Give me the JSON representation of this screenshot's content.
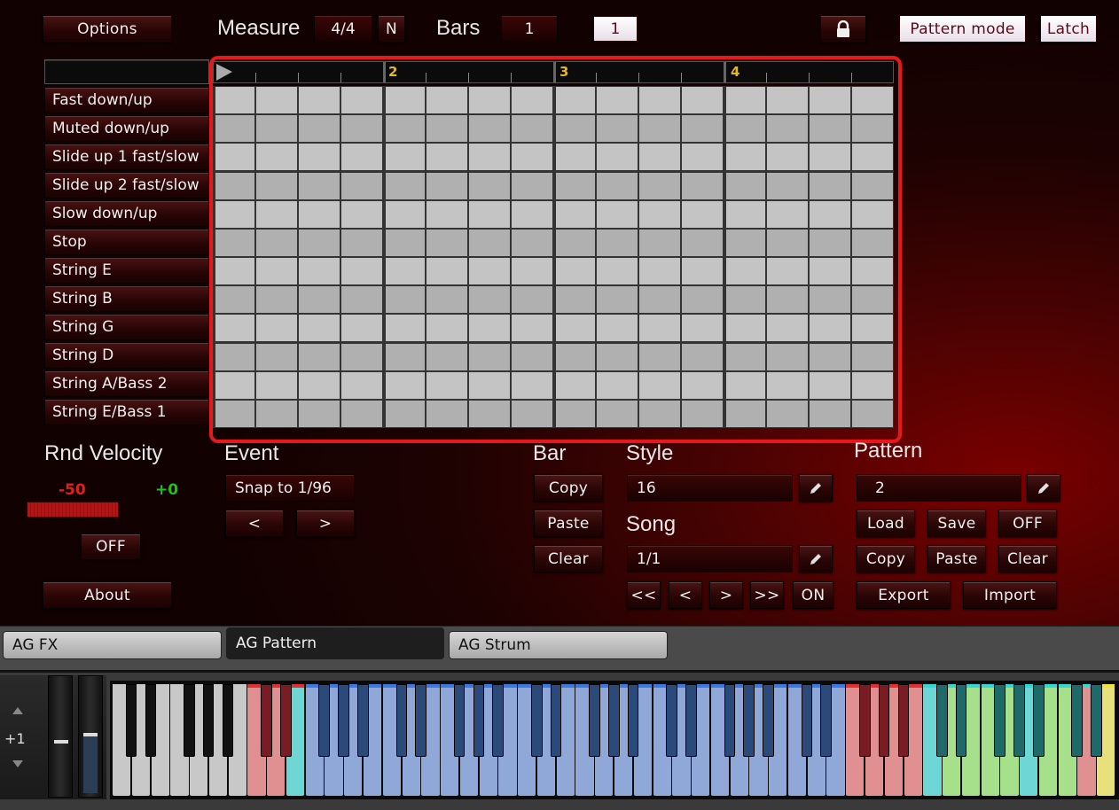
{
  "header": {
    "options_label": "Options",
    "measure_label": "Measure",
    "measure_value": "4/4",
    "n_label": "N",
    "bars_label": "Bars",
    "bars_value": "1",
    "current_bar": "1",
    "lock_icon": "lock-icon",
    "pattern_mode_label": "Pattern mode",
    "latch_label": "Latch"
  },
  "grid": {
    "ruler_marks": [
      "2",
      "3",
      "4"
    ],
    "rows": [
      "Fast down/up",
      "Muted down/up",
      "Slide up 1 fast/slow",
      "Slide up 2 fast/slow",
      "Slow down/up",
      "Stop",
      "String E",
      "String B",
      "String G",
      "String D",
      "String A/Bass 2",
      "String E/Bass 1"
    ]
  },
  "rnd_velocity": {
    "title": "Rnd Velocity",
    "min_value": "-50",
    "max_value": "+0",
    "off_label": "OFF",
    "min_color": "#e02020",
    "max_color": "#20c020"
  },
  "about_label": "About",
  "event": {
    "title": "Event",
    "snap_label": "Snap to 1/96",
    "prev_label": "<",
    "next_label": ">"
  },
  "bar": {
    "title": "Bar",
    "copy_label": "Copy",
    "paste_label": "Paste",
    "clear_label": "Clear"
  },
  "style": {
    "title": "Style",
    "value": "16",
    "edit_icon": "pencil-icon"
  },
  "song": {
    "title": "Song",
    "value": "1/1",
    "edit_icon": "pencil-icon",
    "first_label": "<<",
    "prev_label": "<",
    "next_label": ">",
    "last_label": ">>",
    "on_label": "ON"
  },
  "pattern": {
    "title": "Pattern",
    "value": "2",
    "edit_icon": "pencil-icon",
    "load_label": "Load",
    "save_label": "Save",
    "off_label": "OFF",
    "copy_label": "Copy",
    "paste_label": "Paste",
    "clear_label": "Clear",
    "export_label": "Export",
    "import_label": "Import"
  },
  "tabs": [
    {
      "label": "AG FX"
    },
    {
      "label": "AG Pattern"
    },
    {
      "label": "AG Strum"
    }
  ],
  "keyboard": {
    "octave_value": "+1",
    "up_icon": "triangle-up-icon",
    "down_icon": "triangle-down-icon",
    "colors": {
      "white": "#c8c8c8",
      "pink": "#e09090",
      "cyan": "#6fd6d6",
      "blue": "#8fa8d8",
      "green": "#a6e08a",
      "yellow": "#e8e07a",
      "black_red": "#7a1c24",
      "black_blue": "#2a4a7a",
      "black_teal": "#1e6a6a"
    }
  }
}
